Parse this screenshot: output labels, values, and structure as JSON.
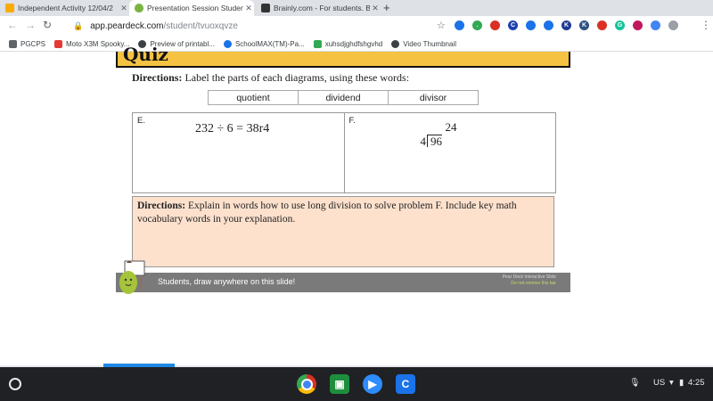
{
  "tabs": [
    {
      "title": "Independent Activity 12/04/2",
      "color": "#f9ab00"
    },
    {
      "title": "Presentation Session Student",
      "color": "#7cb342"
    },
    {
      "title": "Brainly.com - For students. By st",
      "color": "#333333"
    }
  ],
  "new_tab_symbol": "+",
  "address": {
    "host": "app.peardeck.com",
    "path": "/student/tvuoxqvze"
  },
  "extensions": [
    {
      "icon": "blue-circle-icon",
      "color": "#1a73e8",
      "char": ""
    },
    {
      "icon": "green-badge-icon",
      "color": "#34a853",
      "char": "."
    },
    {
      "icon": "red-circle-icon",
      "color": "#d93025",
      "char": ""
    },
    {
      "icon": "c-extension-icon",
      "color": "#1e40af",
      "char": "C"
    },
    {
      "icon": "blue-circle-icon",
      "color": "#1a73e8",
      "char": ""
    },
    {
      "icon": "blue-circle-icon",
      "color": "#1a73e8",
      "char": ""
    },
    {
      "icon": "k-extension-icon",
      "color": "#1f3a93",
      "char": "K"
    },
    {
      "icon": "k-extension-icon",
      "color": "#2c5282",
      "char": "K"
    },
    {
      "icon": "red-circle-icon",
      "color": "#d93025",
      "char": ""
    },
    {
      "icon": "grammarly-icon",
      "color": "#15c39a",
      "char": "G"
    },
    {
      "icon": "pink-circle-icon",
      "color": "#c2185b",
      "char": ""
    },
    {
      "icon": "blue-dot-icon",
      "color": "#4285f4",
      "char": ""
    },
    {
      "icon": "gray-dot-icon",
      "color": "#9aa0a6",
      "char": ""
    }
  ],
  "bookmarks": [
    {
      "label": "PGCPS",
      "color": "#5f6368"
    },
    {
      "label": "Moto X3M Spooky...",
      "color": "#e53935"
    },
    {
      "label": "Preview of printabl...",
      "color": "#3c4043"
    },
    {
      "label": "SchoolMAX(TM)-Pa...",
      "color": "#1a73e8"
    },
    {
      "label": "xuhsdjghdfshgvhd",
      "color": "#34a853"
    },
    {
      "label": "Video Thumbnail",
      "color": "#3c4043"
    }
  ],
  "slide": {
    "quiz_title": "Quiz",
    "directions1_bold": "Directions:",
    "directions1_text": " Label the parts of each diagrams, using these words:",
    "words": [
      "quotient",
      "dividend",
      "divisor"
    ],
    "problem_e_label": "E.",
    "problem_e_equation": "232 ÷ 6 = 38r4",
    "problem_f_label": "F.",
    "problem_f_quotient": "24",
    "problem_f_divisor": "4",
    "problem_f_dividend": "96",
    "directions2_bold": "Directions:",
    "directions2_text": " Explain in words how to use long division to solve problem F. Include key math vocabulary words in your explanation.",
    "footer_text": "Students, draw anywhere on this slide!",
    "footer_right_line1": "Pear Deck Interactive Slide",
    "footer_right_line2": "Do not remove this bar"
  },
  "shelf": {
    "apps": [
      {
        "icon": "chrome-icon",
        "color": "#34a853"
      },
      {
        "icon": "google-classroom-icon",
        "color": "#1e8e3e"
      },
      {
        "icon": "zoom-icon",
        "color": "#2d8cff"
      },
      {
        "icon": "c-app-icon",
        "color": "#1a73e8"
      }
    ],
    "mic_icon": "mic-icon",
    "locale": "US",
    "time": "4:25"
  }
}
